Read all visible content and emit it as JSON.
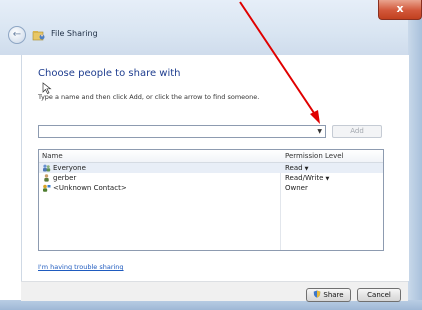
{
  "window": {
    "title": "File Sharing",
    "close_glyph": "x",
    "back_glyph": "←"
  },
  "main": {
    "heading": "Choose people to share with",
    "instructions": "Type a name and then click Add, or click the arrow to find someone.",
    "name_input_value": "",
    "dropdown_glyph": "▼",
    "add_label": "Add"
  },
  "list": {
    "columns": [
      "Name",
      "Permission Level"
    ],
    "rows": [
      {
        "name": "Everyone",
        "permission": "Read",
        "has_dropdown": true,
        "icon": "users-icon"
      },
      {
        "name": "gerber",
        "permission": "Read/Write",
        "has_dropdown": true,
        "icon": "user-icon"
      },
      {
        "name": "<Unknown Contact>",
        "permission": "Owner",
        "has_dropdown": false,
        "icon": "unknown-contact-icon"
      }
    ],
    "perm_dropdown_glyph": "▼"
  },
  "links": {
    "trouble": "I'm having trouble sharing"
  },
  "footer": {
    "share_label": "Share",
    "cancel_label": "Cancel"
  },
  "colors": {
    "heading": "#1e3d8f",
    "link": "#1f5bbf",
    "annotation_arrow": "#e00000"
  }
}
